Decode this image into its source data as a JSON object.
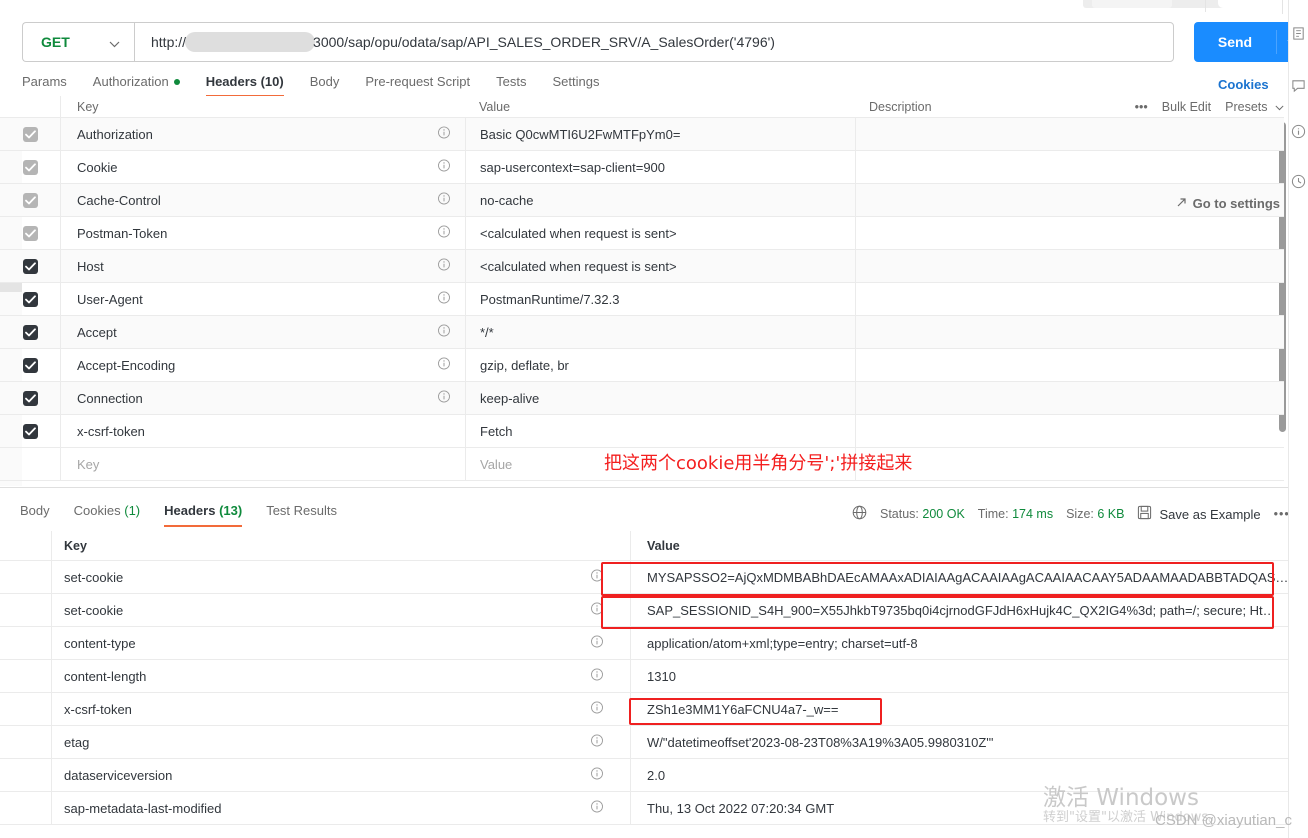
{
  "request": {
    "method": "GET",
    "url_prefix": "http://",
    "url_suffix": "3000/sap/opu/odata/sap/API_SALES_ORDER_SRV/A_SalesOrder('4796')",
    "send_label": "Send",
    "tabs": [
      {
        "label": "Params",
        "active": false,
        "dot": false
      },
      {
        "label": "Authorization",
        "active": false,
        "dot": true
      },
      {
        "label": "Headers (10)",
        "active": true,
        "dot": false
      },
      {
        "label": "Body",
        "active": false,
        "dot": false
      },
      {
        "label": "Pre-request Script",
        "active": false,
        "dot": false
      },
      {
        "label": "Tests",
        "active": false,
        "dot": false
      },
      {
        "label": "Settings",
        "active": false,
        "dot": false
      }
    ],
    "cookies_link": "Cookies",
    "bulk_edit": "Bulk Edit",
    "presets": "Presets",
    "more_dots": "•••",
    "go_to_settings": "Go to settings",
    "columns": {
      "key": "Key",
      "value": "Value",
      "description": "Description"
    },
    "placeholders": {
      "key": "Key",
      "value": "Value"
    },
    "rows": [
      {
        "checked": true,
        "dim": true,
        "key": "Authorization",
        "value": "Basic Q0cwMTI6U2FwMTFpYm0=",
        "info": true
      },
      {
        "checked": true,
        "dim": true,
        "key": "Cookie",
        "value": "sap-usercontext=sap-client=900",
        "info": true
      },
      {
        "checked": true,
        "dim": true,
        "key": "Cache-Control",
        "value": "no-cache",
        "info": true
      },
      {
        "checked": true,
        "dim": true,
        "key": "Postman-Token",
        "value": "<calculated when request is sent>",
        "info": true
      },
      {
        "checked": true,
        "dim": false,
        "key": "Host",
        "value": "<calculated when request is sent>",
        "info": true
      },
      {
        "checked": true,
        "dim": false,
        "key": "User-Agent",
        "value": "PostmanRuntime/7.32.3",
        "info": true
      },
      {
        "checked": true,
        "dim": false,
        "key": "Accept",
        "value": "*/*",
        "info": true
      },
      {
        "checked": true,
        "dim": false,
        "key": "Accept-Encoding",
        "value": "gzip, deflate, br",
        "info": true
      },
      {
        "checked": true,
        "dim": false,
        "key": "Connection",
        "value": "keep-alive",
        "info": true
      },
      {
        "checked": true,
        "dim": false,
        "key": "x-csrf-token",
        "value": "Fetch",
        "info": false
      }
    ]
  },
  "annotation": {
    "text": "把这两个cookie用半角分号';'拼接起来",
    "color": "#f41f1f"
  },
  "response": {
    "tabs": [
      {
        "label": "Body",
        "count": "",
        "active": false
      },
      {
        "label": "Cookies",
        "count": "(1)",
        "active": false
      },
      {
        "label": "Headers",
        "count": "(13)",
        "active": true
      },
      {
        "label": "Test Results",
        "count": "",
        "active": false
      }
    ],
    "status_label": "Status:",
    "status_value": "200 OK",
    "time_label": "Time:",
    "time_value": "174 ms",
    "size_label": "Size:",
    "size_value": "6 KB",
    "save_as_example": "Save as Example",
    "more_dots": "•••",
    "columns": {
      "key": "Key",
      "value": "Value"
    },
    "rows": [
      {
        "key": "set-cookie",
        "value": "MYSAPSSO2=AjQxMDMBABhDAEcAMAAxADIAIAAgACAAIAAgACAAIAACAAY5ADAAMAADABBTADQAS…",
        "highlight": true
      },
      {
        "key": "set-cookie",
        "value": "SAP_SESSIONID_S4H_900=X55JhkbT9735bq0i4cjrnodGFJdH6xHujk4C_QX2IG4%3d; path=/; secure; Ht…",
        "highlight": true
      },
      {
        "key": "content-type",
        "value": "application/atom+xml;type=entry; charset=utf-8",
        "highlight": false
      },
      {
        "key": "content-length",
        "value": "1310",
        "highlight": false
      },
      {
        "key": "x-csrf-token",
        "value": "ZSh1e3MM1Y6aFCNU4a7-_w==",
        "highlight": true
      },
      {
        "key": "etag",
        "value": "W/\"datetimeoffset'2023-08-23T08%3A19%3A05.9980310Z'\"",
        "highlight": false
      },
      {
        "key": "dataserviceversion",
        "value": "2.0",
        "highlight": false
      },
      {
        "key": "sap-metadata-last-modified",
        "value": "Thu, 13 Oct 2022 07:20:34 GMT",
        "highlight": false
      }
    ]
  },
  "watermarks": {
    "windows_line1": "激活 Windows",
    "windows_line2": "转到\"设置\"以激活 Windows。",
    "csdn": "CSDN @xiayutian_c"
  },
  "colors": {
    "accent_orange": "#f26b3a",
    "send_blue": "#1a8cff",
    "method_green": "#0f8a3c",
    "link_blue": "#1a73cf",
    "highlight_red": "#ef2020"
  }
}
